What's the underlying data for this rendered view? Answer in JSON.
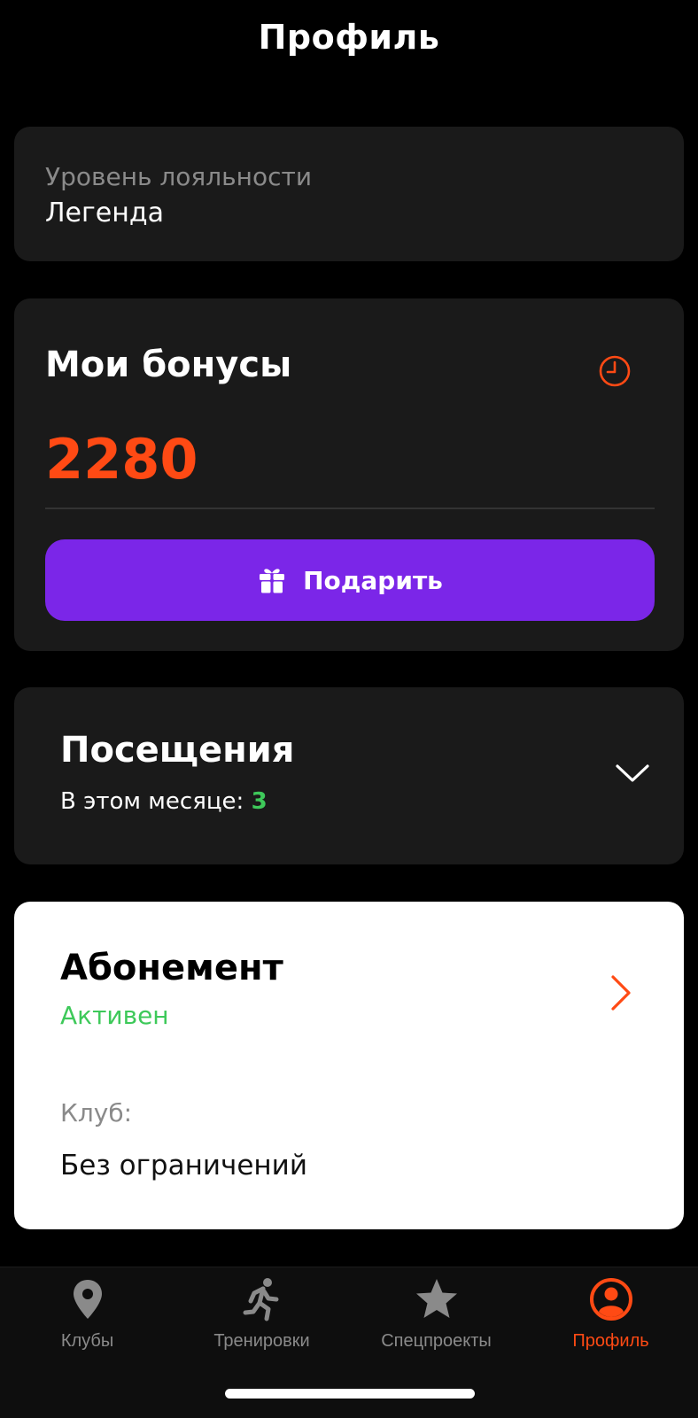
{
  "header": {
    "title": "Профиль"
  },
  "loyalty": {
    "label": "Уровень лояльности",
    "value": "Легенда"
  },
  "bonuses": {
    "title": "Мои бонусы",
    "amount": "2280",
    "history_icon": "clock-icon",
    "gift_button_label": "Подарить",
    "gift_icon": "gift-icon"
  },
  "visits": {
    "title": "Посещения",
    "month_label": "В этом месяце:",
    "month_count": "3",
    "expand_icon": "chevron-down-icon"
  },
  "subscription": {
    "title": "Абонемент",
    "status": "Активен",
    "club_label": "Клуб:",
    "club_value": "Без ограничений",
    "open_icon": "chevron-right-icon"
  },
  "tabbar": {
    "items": [
      {
        "label": "Клубы",
        "icon": "map-pin-icon",
        "active": false
      },
      {
        "label": "Тренировки",
        "icon": "running-person-icon",
        "active": false
      },
      {
        "label": "Спецпроекты",
        "icon": "star-icon",
        "active": false
      },
      {
        "label": "Профиль",
        "icon": "profile-icon",
        "active": true
      }
    ]
  },
  "colors": {
    "accent_orange": "#ff4a14",
    "accent_purple": "#7b26e8",
    "success_green": "#3ec95a",
    "card_bg": "#1a1a1a"
  }
}
